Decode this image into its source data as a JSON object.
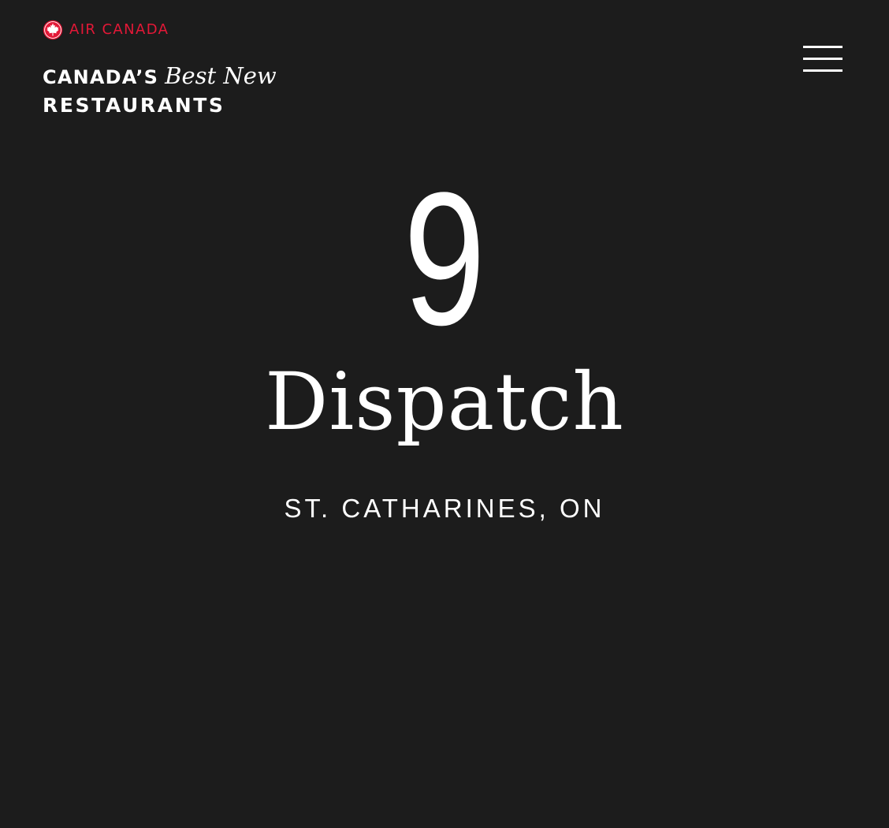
{
  "header": {
    "brand_name": "AIR CANADA",
    "brand_color": "#e31837",
    "logo_icon": "maple-leaf-roundel-icon",
    "title_part1": "CANADA’S",
    "title_part2": "Best New",
    "title_part3": "RESTAURANTS",
    "menu_icon": "hamburger-menu-icon"
  },
  "hero": {
    "rank": "9",
    "name": "Dispatch",
    "location": "ST. CATHARINES, ON"
  },
  "colors": {
    "background": "#1c1c1c",
    "text": "#ffffff",
    "accent": "#e31837"
  }
}
